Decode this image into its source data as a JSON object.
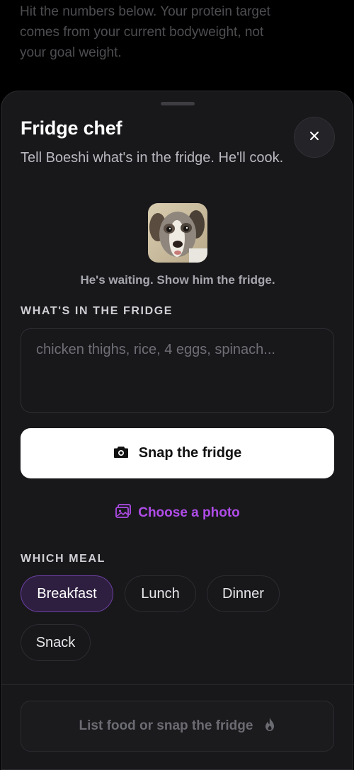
{
  "background": {
    "intro_text": "Hit the numbers below. Your protein target comes from your current bodyweight, not your goal weight."
  },
  "sheet": {
    "title": "Fridge chef",
    "subtitle": "Tell Boeshi what's in the fridge. He'll cook.",
    "close_icon": "close-icon",
    "avatar_caption": "He's waiting. Show him the fridge.",
    "fridge_section_label": "WHAT'S IN THE FRIDGE",
    "fridge_input": {
      "value": "",
      "placeholder": "chicken thighs, rice, 4 eggs, spinach..."
    },
    "snap_button_label": "Snap the fridge",
    "snap_icon": "camera-icon",
    "choose_photo_label": "Choose a photo",
    "choose_photo_icon": "image-icon",
    "meal_section_label": "WHICH MEAL",
    "meals": [
      "Breakfast",
      "Lunch",
      "Dinner",
      "Snack"
    ],
    "selected_meal": "Breakfast",
    "submit_label": "List food or snap the fridge",
    "submit_icon": "flame-icon"
  },
  "colors": {
    "accent": "#b04ce8",
    "sheet_bg": "#18181b",
    "chip_active_bg": "#2e1f40"
  }
}
